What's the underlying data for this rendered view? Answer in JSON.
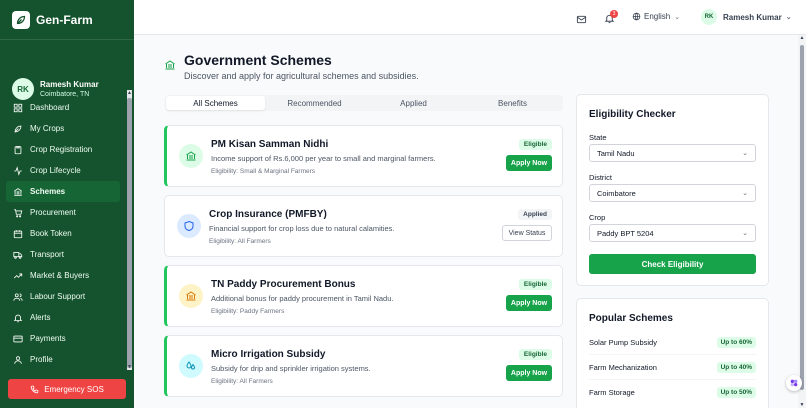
{
  "app": {
    "name": "Gen-Farm"
  },
  "user": {
    "initials": "RK",
    "name": "Ramesh Kumar",
    "location": "Coimbatore, TN"
  },
  "sidebar": {
    "items": [
      {
        "label": "Dashboard",
        "icon": "dashboard-icon",
        "active": false
      },
      {
        "label": "My Crops",
        "icon": "leaf-icon",
        "active": false
      },
      {
        "label": "Crop Registration",
        "icon": "clipboard-icon",
        "active": false
      },
      {
        "label": "Crop Lifecycle",
        "icon": "activity-icon",
        "active": false
      },
      {
        "label": "Schemes",
        "icon": "bank-icon",
        "active": true
      },
      {
        "label": "Procurement",
        "icon": "cart-icon",
        "active": false
      },
      {
        "label": "Book Token",
        "icon": "calendar-icon",
        "active": false
      },
      {
        "label": "Transport",
        "icon": "truck-icon",
        "active": false
      },
      {
        "label": "Market & Buyers",
        "icon": "trending-icon",
        "active": false
      },
      {
        "label": "Labour Support",
        "icon": "users-icon",
        "active": false
      },
      {
        "label": "Alerts",
        "icon": "bell-icon",
        "active": false
      },
      {
        "label": "Payments",
        "icon": "credit-card-icon",
        "active": false
      },
      {
        "label": "Profile",
        "icon": "user-icon",
        "active": false
      }
    ],
    "sos_label": "Emergency SOS"
  },
  "topbar": {
    "notification_count": "3",
    "language": "English",
    "user_initials": "RK",
    "user_name": "Ramesh Kumar"
  },
  "page": {
    "title": "Government Schemes",
    "subtitle": "Discover and apply for agricultural schemes and subsidies."
  },
  "tabs": [
    {
      "label": "All Schemes",
      "active": true
    },
    {
      "label": "Recommended",
      "active": false
    },
    {
      "label": "Applied",
      "active": false
    },
    {
      "label": "Benefits",
      "active": false
    }
  ],
  "schemes": [
    {
      "title": "PM Kisan Samman Nidhi",
      "description": "Income support of Rs.6,000 per year to small and marginal farmers.",
      "eligibility": "Eligibility: Small & Marginal Farmers",
      "status": "Eligible",
      "action": "Apply Now",
      "icon": "bank-icon",
      "icon_bg": "#dcfce7",
      "icon_color": "#16a34a"
    },
    {
      "title": "Crop Insurance (PMFBY)",
      "description": "Financial support for crop loss due to natural calamities.",
      "eligibility": "Eligibility: All Farmers",
      "status": "Applied",
      "action": "View Status",
      "icon": "shield-icon",
      "icon_bg": "#dbeafe",
      "icon_color": "#2563eb"
    },
    {
      "title": "TN Paddy Procurement Bonus",
      "description": "Additional bonus for paddy procurement in Tamil Nadu.",
      "eligibility": "Eligibility: Paddy Farmers",
      "status": "Eligible",
      "action": "Apply Now",
      "icon": "bank-icon",
      "icon_bg": "#fef3c7",
      "icon_color": "#d97706"
    },
    {
      "title": "Micro Irrigation Subsidy",
      "description": "Subsidy for drip and sprinkler irrigation systems.",
      "eligibility": "Eligibility: All Farmers",
      "status": "Eligible",
      "action": "Apply Now",
      "icon": "droplets-icon",
      "icon_bg": "#cffafe",
      "icon_color": "#0891b2"
    }
  ],
  "eligibility": {
    "title": "Eligibility Checker",
    "state_label": "State",
    "state_value": "Tamil Nadu",
    "district_label": "District",
    "district_value": "Coimbatore",
    "crop_label": "Crop",
    "crop_value": "Paddy BPT 5204",
    "button": "Check Eligibility"
  },
  "popular": {
    "title": "Popular Schemes",
    "items": [
      {
        "name": "Solar Pump Subsidy",
        "badge": "Up to 60%"
      },
      {
        "name": "Farm Mechanization",
        "badge": "Up to 40%"
      },
      {
        "name": "Farm Storage",
        "badge": "Up to 50%"
      }
    ]
  }
}
